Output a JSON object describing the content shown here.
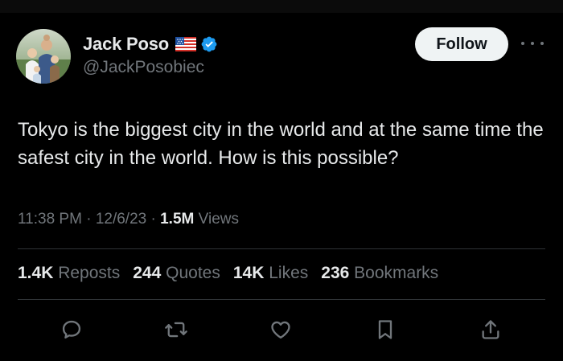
{
  "author": {
    "display_name": "Jack Poso",
    "handle": "@JackPosobiec",
    "flag": "us-flag-icon",
    "verified": true
  },
  "follow_button": {
    "label": "Follow"
  },
  "tweet": {
    "text": "Tokyo is the biggest city in the world and at the same time the safest city in the world. How is this possible?",
    "time": "11:38 PM",
    "date": "12/6/23",
    "views_count": "1.5M",
    "views_label": "Views",
    "separator": "·"
  },
  "stats": [
    {
      "count": "1.4K",
      "label": "Reposts"
    },
    {
      "count": "244",
      "label": "Quotes"
    },
    {
      "count": "14K",
      "label": "Likes"
    },
    {
      "count": "236",
      "label": "Bookmarks"
    }
  ],
  "actions": [
    "reply-icon",
    "repost-icon",
    "like-icon",
    "bookmark-icon",
    "share-icon"
  ],
  "colors": {
    "background": "#000000",
    "text": "#e7e9ea",
    "muted": "#71767b",
    "divider": "#2f3336",
    "verified": "#1d9bf0",
    "follow_bg": "#eff3f4"
  }
}
